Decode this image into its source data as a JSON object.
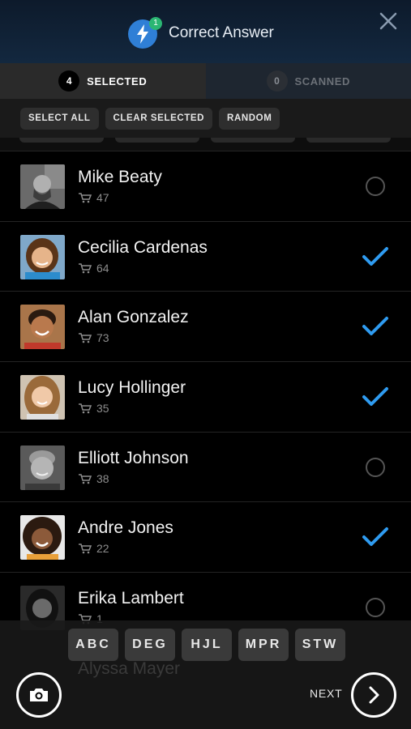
{
  "header": {
    "title": "Correct Answer",
    "badge": "1",
    "logo_icon": "lightning-bolt-icon",
    "close_icon": "close-icon"
  },
  "tabs": [
    {
      "count": "4",
      "label": "SELECTED",
      "active": true
    },
    {
      "count": "0",
      "label": "SCANNED",
      "active": false
    }
  ],
  "actions": {
    "select_all": "SELECT ALL",
    "clear_selected": "CLEAR SELECTED",
    "random": "RANDOM"
  },
  "students": [
    {
      "name": "Mike Beaty",
      "count": "47",
      "selected": false
    },
    {
      "name": "Cecilia Cardenas",
      "count": "64",
      "selected": true
    },
    {
      "name": "Alan Gonzalez",
      "count": "73",
      "selected": true
    },
    {
      "name": "Lucy Hollinger",
      "count": "35",
      "selected": true
    },
    {
      "name": "Elliott Johnson",
      "count": "38",
      "selected": false
    },
    {
      "name": "Andre Jones",
      "count": "22",
      "selected": true
    },
    {
      "name": "Erika Lambert",
      "count": "1",
      "selected": false
    }
  ],
  "partial_student": "Alyssa Mayer",
  "alphabet": [
    "ABC",
    "DEG",
    "HJL",
    "MPR",
    "STW"
  ],
  "footer": {
    "next_label": "NEXT",
    "camera_icon": "camera-icon",
    "next_icon": "chevron-right-icon"
  },
  "colors": {
    "accent": "#2f9bf0",
    "header_top": "#0d1a2b",
    "badge_green": "#2bb673"
  }
}
